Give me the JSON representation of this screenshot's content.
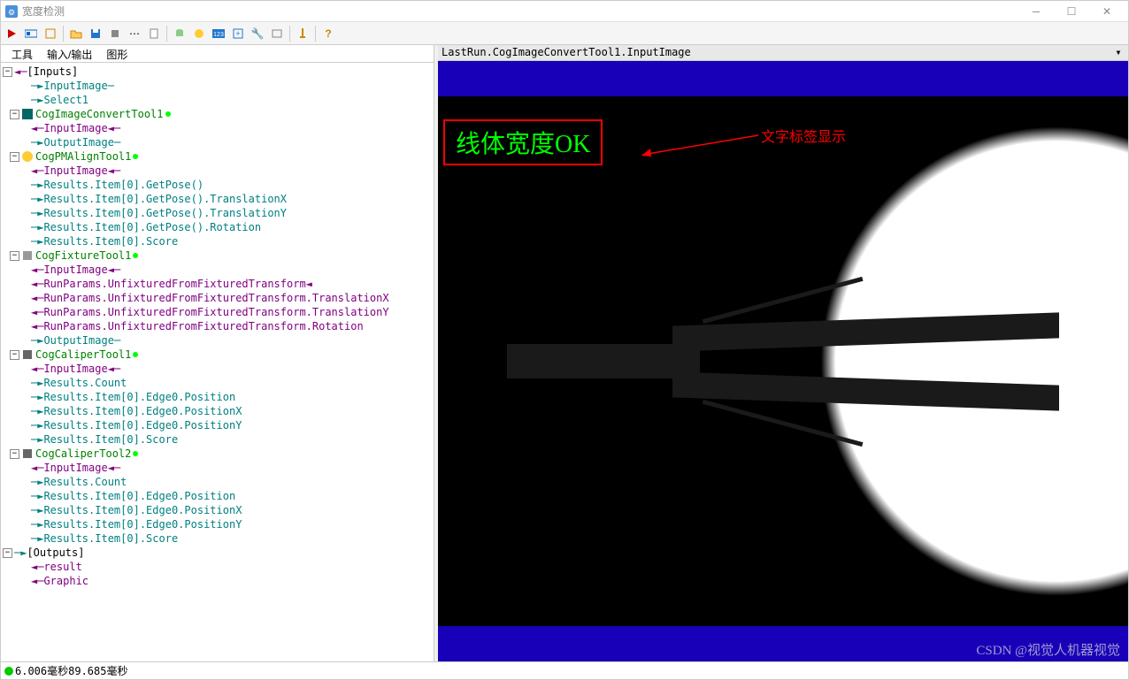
{
  "window": {
    "title": "宽度检测"
  },
  "menubar": {
    "tools": "工具",
    "io": "输入/输出",
    "graphics": "图形"
  },
  "tree": {
    "inputs": "[Inputs]",
    "inputImage": "InputImage",
    "select1": "Select1",
    "cogImageConvertTool1": "CogImageConvertTool1",
    "outputImage": "OutputImage",
    "cogPMAlignTool1": "CogPMAlignTool1",
    "resultsGetPose": "Results.Item[0].GetPose()",
    "resultsGetPoseTransX": "Results.Item[0].GetPose().TranslationX",
    "resultsGetPoseTransY": "Results.Item[0].GetPose().TranslationY",
    "resultsGetPoseRotation": "Results.Item[0].GetPose().Rotation",
    "resultsScore": "Results.Item[0].Score",
    "cogFixtureTool1": "CogFixtureTool1",
    "runParamsUnfix": "RunParams.UnfixturedFromFixturedTransform",
    "runParamsUnfixTransX": "RunParams.UnfixturedFromFixturedTransform.TranslationX",
    "runParamsUnfixTransY": "RunParams.UnfixturedFromFixturedTransform.TranslationY",
    "runParamsUnfixRotation": "RunParams.UnfixturedFromFixturedTransform.Rotation",
    "cogCaliperTool1": "CogCaliperTool1",
    "resultsCount": "Results.Count",
    "resultsEdgePos": "Results.Item[0].Edge0.Position",
    "resultsEdgePosX": "Results.Item[0].Edge0.PositionX",
    "resultsEdgePosY": "Results.Item[0].Edge0.PositionY",
    "cogCaliperTool2": "CogCaliperTool2",
    "outputs": "[Outputs]",
    "result": "result",
    "graphic": "Graphic"
  },
  "imageHeader": "LastRun.CogImageConvertTool1.InputImage",
  "overlay": {
    "text": "线体宽度OK",
    "annotation": "文字标签显示"
  },
  "statusbar": "6.006毫秒89.685毫秒",
  "watermark": "CSDN @视觉人机器视觉"
}
